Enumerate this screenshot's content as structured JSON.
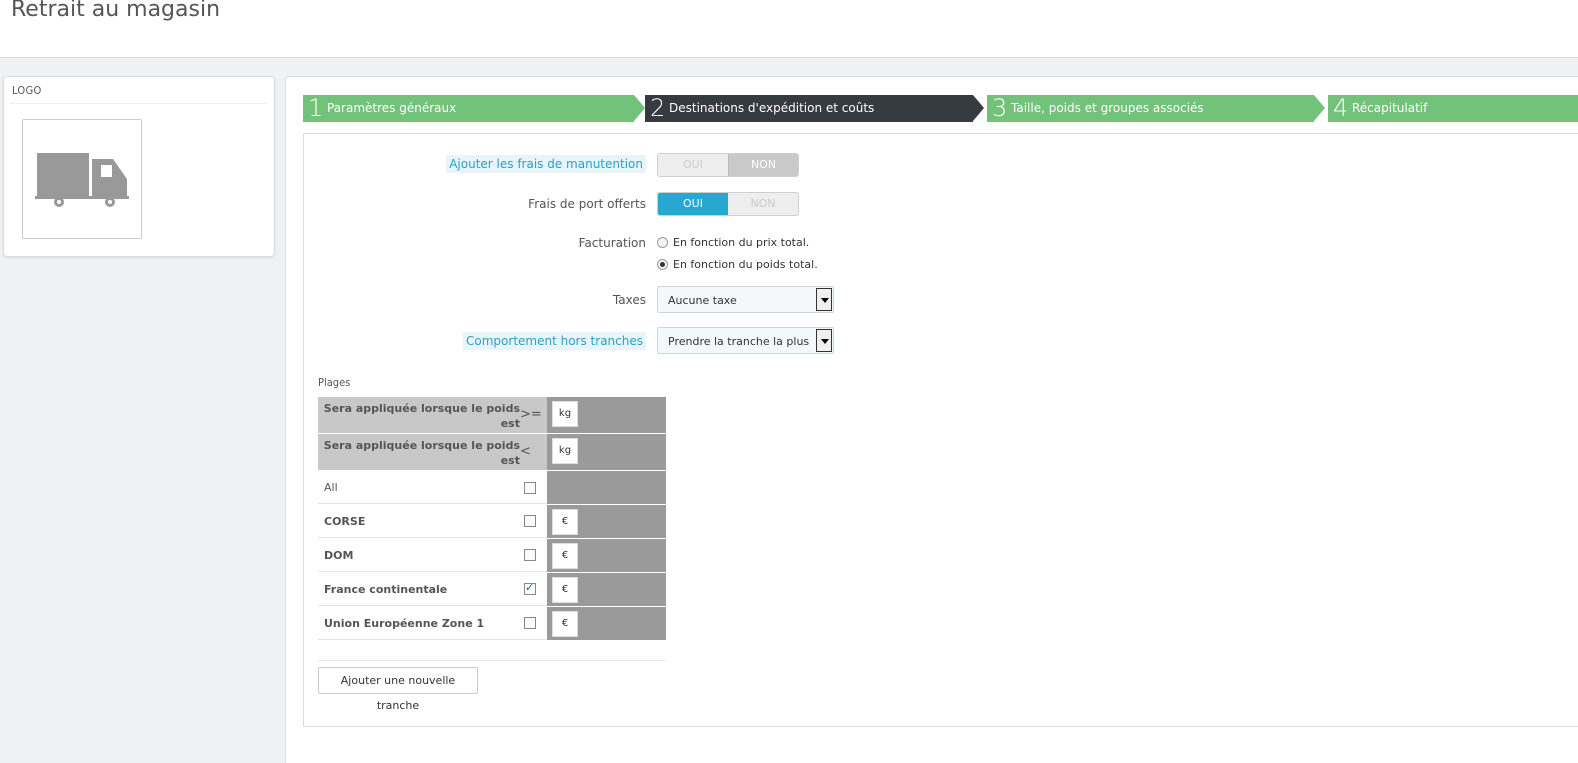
{
  "page": {
    "title": "Retrait au magasin"
  },
  "logo_panel": {
    "heading": "LOGO",
    "icon": "truck-icon"
  },
  "steps": [
    {
      "num": "1",
      "label": "Paramètres généraux",
      "active": false
    },
    {
      "num": "2",
      "label": "Destinations d'expédition et coûts",
      "active": true
    },
    {
      "num": "3",
      "label": "Taille, poids et groupes associés",
      "active": false
    },
    {
      "num": "4",
      "label": "Récapitulatif",
      "active": false
    }
  ],
  "form": {
    "handling_fees": {
      "label": "Ajouter les frais de manutention",
      "yes": "OUI",
      "no": "NON",
      "value": "NON"
    },
    "free_shipping": {
      "label": "Frais de port offerts",
      "yes": "OUI",
      "no": "NON",
      "value": "OUI"
    },
    "billing": {
      "label": "Facturation",
      "options": [
        "En fonction du prix total.",
        "En fonction du poids total."
      ],
      "selected": "En fonction du poids total."
    },
    "taxes": {
      "label": "Taxes",
      "value": "Aucune taxe"
    },
    "out_of_range": {
      "label": "Comportement hors tranches",
      "value": "Prendre la tranche la plus grande"
    }
  },
  "plages": {
    "label": "Plages",
    "conditions": [
      {
        "label": "Sera appliquée lorsque le poids est",
        "operator": ">=",
        "unit": "kg"
      },
      {
        "label": "Sera appliquée lorsque le poids est",
        "operator": "<",
        "unit": "kg"
      }
    ],
    "zones": [
      {
        "name": "All",
        "checked": false,
        "currency": ""
      },
      {
        "name": "CORSE",
        "checked": false,
        "currency": "€"
      },
      {
        "name": "DOM",
        "checked": false,
        "currency": "€"
      },
      {
        "name": "France continentale",
        "checked": true,
        "currency": "€"
      },
      {
        "name": "Union Européenne Zone 1",
        "checked": false,
        "currency": "€"
      }
    ],
    "add_button": "Ajouter une nouvelle tranche"
  },
  "colors": {
    "step": "#72c279",
    "step_active": "#363a41",
    "switch_on": "#27a8d0",
    "hint": "#2aa0c9"
  }
}
